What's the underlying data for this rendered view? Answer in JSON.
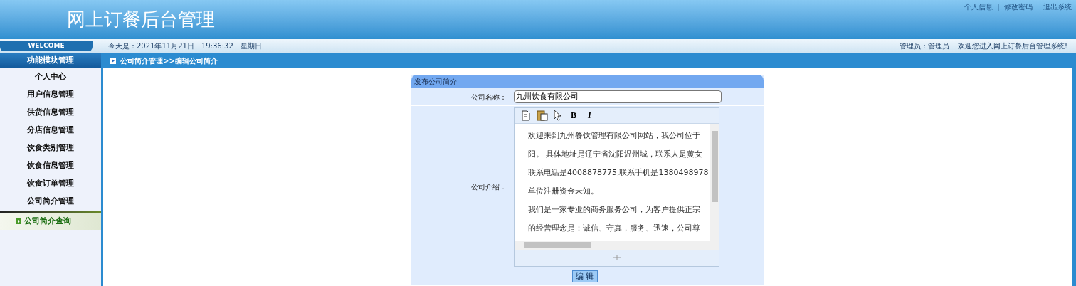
{
  "header": {
    "title": "网上订餐后台管理",
    "links": [
      "个人信息",
      "修改密码",
      "退出系统"
    ],
    "separator": "|"
  },
  "welcome_bar": {
    "badge": "WELCOME",
    "date": "今天是：2021年11月21日　19:36:32　星期日",
    "admin": "管理员：管理员",
    "greeting": "欢迎您进入网上订餐后台管理系统!"
  },
  "sidebar": {
    "heading": "功能模块管理",
    "items": [
      {
        "label": "个人中心",
        "selected": false
      },
      {
        "label": "用户信息管理",
        "selected": false
      },
      {
        "label": "供货信息管理",
        "selected": false
      },
      {
        "label": "分店信息管理",
        "selected": false
      },
      {
        "label": "饮食类别管理",
        "selected": false
      },
      {
        "label": "饮食信息管理",
        "selected": false
      },
      {
        "label": "饮食订单管理",
        "selected": false
      },
      {
        "label": "公司简介管理",
        "selected": false
      }
    ],
    "sub_items": [
      {
        "label": "公司简介查询",
        "selected": true
      }
    ]
  },
  "breadcrumb": "公司简介管理>>编辑公司简介",
  "form": {
    "title": "发布公司简介",
    "name_label": "公司名称：",
    "name_value": "九州饮食有限公司",
    "intro_label": "公司介绍：",
    "editor_lines": [
      "欢迎来到九州餐饮管理有限公司网站，我公司位于",
      "阳。 具体地址是辽宁省沈阳温州城，联系人是黄女",
      "联系电话是4008878775,联系手机是1380498978",
      "单位注册资金未知。",
      "我们是一家专业的商务服务公司，为客户提供正宗",
      "的经营理念是：诚信、守真，服务、迅速，公司尊"
    ],
    "toolbar": [
      {
        "kind": "page"
      },
      {
        "kind": "paste"
      },
      {
        "kind": "pointer"
      },
      {
        "kind": "bold",
        "label": "B"
      },
      {
        "kind": "italic",
        "label": "I"
      }
    ],
    "button": "编 辑"
  }
}
